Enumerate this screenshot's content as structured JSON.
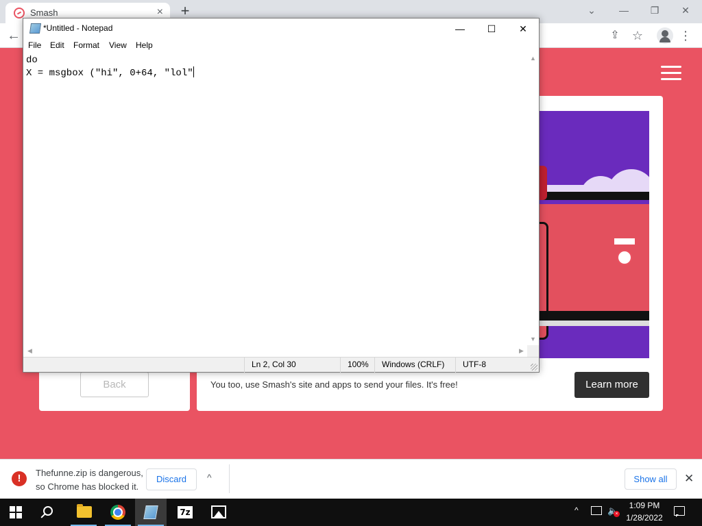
{
  "browser": {
    "tab_title": "Smash",
    "tab_close": "×",
    "new_tab": "+",
    "window_controls": {
      "chevron": "⌄",
      "minimize": "—",
      "restore": "❐",
      "close": "✕"
    },
    "toolbar": {
      "back": "←",
      "share": "⇪",
      "star": "☆",
      "menu": "⋮"
    }
  },
  "page": {
    "back_button": "Back",
    "promo_text": "You too, use Smash's site and apps to send your files. It's free!",
    "learn_more_button": "Learn more",
    "accent_color": "#ea5362"
  },
  "notepad": {
    "title": "*Untitled - Notepad",
    "controls": {
      "minimize": "—",
      "maximize": "☐",
      "close": "✕"
    },
    "menu": [
      "File",
      "Edit",
      "Format",
      "View",
      "Help"
    ],
    "content_lines": [
      "do",
      "X = msgbox (\"hi\", 0+64, \"lol\""
    ],
    "status": {
      "position": "Ln 2, Col 30",
      "zoom": "100%",
      "line_endings": "Windows (CRLF)",
      "encoding": "UTF-8"
    },
    "scroll_arrows": {
      "up": "▲",
      "down": "▼",
      "left": "◀",
      "right": "▶"
    }
  },
  "download_bar": {
    "warning_icon": "!",
    "message_line1": "Thefunne.zip is dangerous,",
    "message_line2": "so Chrome has blocked it.",
    "discard_button": "Discard",
    "chevron": "^",
    "show_all_button": "Show all",
    "close": "✕"
  },
  "taskbar": {
    "apps": [
      "file-explorer",
      "chrome",
      "notepad",
      "7zip",
      "photos"
    ],
    "zip_label": "7z",
    "tray_chevron": "^",
    "volume": "🔈",
    "mute_badge": "×",
    "time": "1:09 PM",
    "date": "1/28/2022"
  }
}
